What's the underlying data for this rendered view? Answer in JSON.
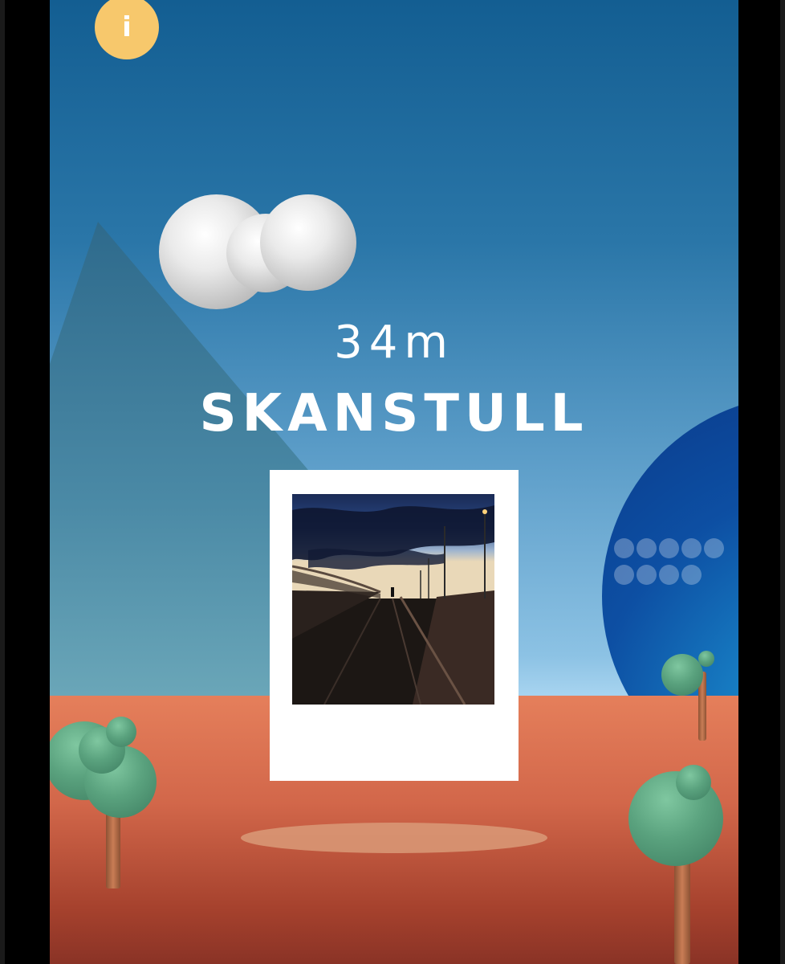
{
  "screen": {
    "info_button_label": "i",
    "distance": "34m",
    "station_name": "SKANSTULL"
  },
  "colors": {
    "sky_top": "#135e92",
    "sky_bottom": "#a6d3ef",
    "ground": "#d2674a",
    "planet": "#0d4fa3",
    "info_button": "#f7c86c",
    "tree_leaves": "#5aa27e"
  },
  "icons": [
    "info-icon"
  ]
}
